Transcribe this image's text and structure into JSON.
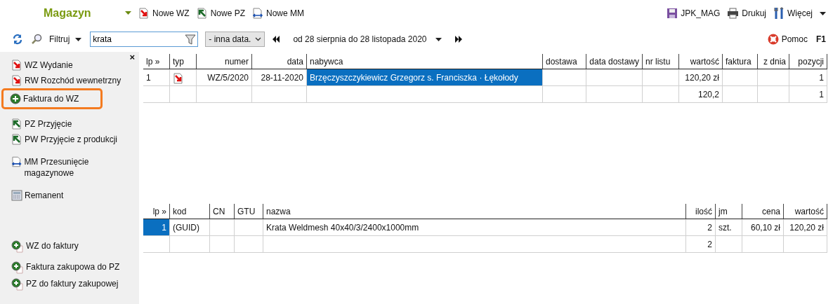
{
  "app_title": "Magazyn",
  "toolbar": [
    {
      "label": "Nowe WZ",
      "kind": "issue"
    },
    {
      "label": "Nowe PZ",
      "kind": "receipt"
    },
    {
      "label": "Nowe MM",
      "kind": "transfer"
    }
  ],
  "toolbar_right": [
    {
      "label": "JPK_MAG",
      "kind": "disk",
      "has_menu": false
    },
    {
      "label": "Drukuj",
      "kind": "printer",
      "has_menu": false
    },
    {
      "label": "Więcej",
      "kind": "tools",
      "has_menu": true
    }
  ],
  "filter": {
    "label": "Filtruj",
    "search": "krata",
    "date_mode": "- inna data.",
    "range": "od 28 sierpnia do 28 listopada 2020"
  },
  "help": {
    "label": "Pomoc",
    "key": "F1"
  },
  "sidebar": {
    "close": "×",
    "top_groups": [
      [
        {
          "label": "WZ Wydanie",
          "kind": "issue",
          "highlighted": false
        },
        {
          "label": "RW Rozchód wewnetrzny",
          "kind": "issue",
          "highlighted": false
        },
        {
          "label": "Faktura do WZ",
          "kind": "add",
          "highlighted": true
        }
      ],
      [
        {
          "label": "PZ Przyjęcie",
          "kind": "receipt",
          "highlighted": false
        },
        {
          "label": "PW Przyjęcie z produkcji",
          "kind": "receipt",
          "highlighted": false
        }
      ],
      [
        {
          "label": "MM Przesunięcie magazynowe",
          "kind": "transfer",
          "highlighted": false
        }
      ],
      [
        {
          "label": "Remanent",
          "kind": "calculator",
          "highlighted": false
        }
      ]
    ],
    "bottom_groups": [
      [
        {
          "label": "WZ do faktury",
          "kind": "link",
          "highlighted": false
        }
      ],
      [
        {
          "label": "Faktura zakupowa do PZ",
          "kind": "link",
          "highlighted": false
        },
        {
          "label": "PZ do faktury zakupowej",
          "kind": "link",
          "highlighted": false
        }
      ]
    ]
  },
  "documents_table": {
    "columns": [
      {
        "label": "lp »",
        "kind": "text"
      },
      {
        "label": "typ",
        "kind": "icon"
      },
      {
        "label": "numer",
        "kind": "text"
      },
      {
        "label": "data",
        "kind": "text"
      },
      {
        "label": "nabywca",
        "kind": "text"
      },
      {
        "label": "dostawa",
        "kind": "text"
      },
      {
        "label": "data dostawy",
        "kind": "text"
      },
      {
        "label": "nr listu",
        "kind": "text"
      },
      {
        "label": "wartość",
        "kind": "text"
      },
      {
        "label": "faktura",
        "kind": "text"
      },
      {
        "label": "z dnia",
        "kind": "text"
      },
      {
        "label": "pozycji",
        "kind": "text"
      }
    ],
    "rows": [
      {
        "kind": "issue",
        "cells": [
          {
            "text": "1",
            "selected": false
          },
          {
            "selected": false
          },
          {
            "text": "WZ/5/2020",
            "selected": false
          },
          {
            "text": "28-11-2020",
            "selected": false
          },
          {
            "text": "Brzęczyszczykiewicz Grzegorz s. Franciszka · Łękołody",
            "selected": true
          },
          {
            "selected": false
          },
          {
            "selected": false
          },
          {
            "selected": false
          },
          {
            "text": "120,20 zł",
            "selected": false
          },
          {
            "selected": false
          },
          {
            "selected": false
          },
          {
            "text": "1",
            "selected": false
          }
        ]
      },
      {
        "kind": "total",
        "cells": [
          {
            "selected": false
          },
          {
            "selected": false
          },
          {
            "selected": false
          },
          {
            "selected": false
          },
          {
            "selected": false
          },
          {
            "selected": false
          },
          {
            "selected": false
          },
          {
            "selected": false
          },
          {
            "text": "120,2",
            "selected": false
          },
          {
            "selected": false
          },
          {
            "selected": false
          },
          {
            "text": "1",
            "selected": false
          }
        ]
      }
    ]
  },
  "items_table": {
    "columns": [
      {
        "label": "lp »",
        "kind": "text"
      },
      {
        "label": "kod",
        "kind": "text"
      },
      {
        "label": "CN",
        "kind": "text"
      },
      {
        "label": "GTU",
        "kind": "text"
      },
      {
        "label": "nazwa",
        "kind": "text"
      },
      {
        "label": "ilość",
        "kind": "text"
      },
      {
        "label": "jm",
        "kind": "text"
      },
      {
        "label": "cena",
        "kind": "text"
      },
      {
        "label": "wartość",
        "kind": "text"
      }
    ],
    "rows": [
      {
        "cells": [
          {
            "text": "1",
            "selected": true
          },
          {
            "text": "(GUID)",
            "selected": false
          },
          {
            "selected": false
          },
          {
            "selected": false
          },
          {
            "text": "Krata Weldmesh 40x40/3/2400x1000mm",
            "selected": false
          },
          {
            "text": "2",
            "selected": false
          },
          {
            "text": "szt.",
            "selected": false
          },
          {
            "text": "60,10 zł",
            "selected": false
          },
          {
            "text": "120,20 zł",
            "selected": false
          }
        ]
      },
      {
        "cells": [
          {
            "selected": false
          },
          {
            "selected": false
          },
          {
            "selected": false
          },
          {
            "selected": false
          },
          {
            "selected": false
          },
          {
            "text": "2",
            "selected": false
          },
          {
            "selected": false
          },
          {
            "selected": false
          },
          {
            "selected": false
          }
        ]
      }
    ]
  }
}
